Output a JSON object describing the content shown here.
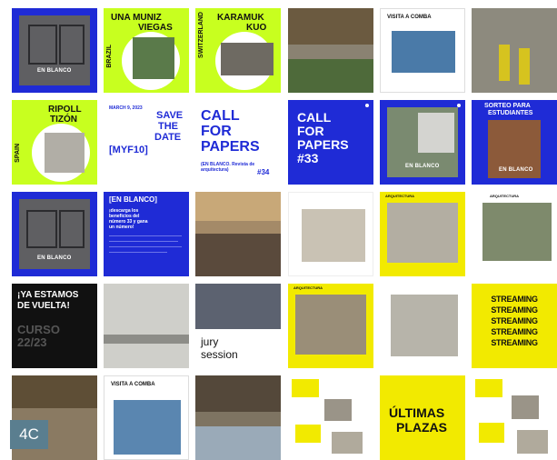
{
  "tiles": {
    "en_blanco_label": "EN BLANCO",
    "brazil": {
      "name_line1": "UNA MUNIZ",
      "name_line2": "VIEGAS",
      "country": "BRAZIL"
    },
    "switzerland": {
      "name_line1": "KARAMUK",
      "name_line2": "KUO",
      "country": "SWITZERLAND"
    },
    "visita_combs_1": "VISITA A COMBA",
    "spain": {
      "name_line1": "RIPOLL",
      "name_line2": "TIZÓN",
      "country": "SPAIN"
    },
    "save_the_date": {
      "date": "MARCH 9, 2023",
      "line1": "SAVE",
      "line2": "THE",
      "line3": "DATE",
      "code": "[MYF10]"
    },
    "call34": {
      "line1": "CALL",
      "line2": "FOR",
      "line3": "PAPERS",
      "sub": "(EN BLANCO. Revista de arquitectura)",
      "num": "#34"
    },
    "call33": {
      "line1": "CALL",
      "line2": "FOR",
      "line3": "PAPERS",
      "num": "#33"
    },
    "sorteo": {
      "line1": "SORTEO PARA",
      "line2": "ESTUDIANTES"
    },
    "en_blanco_card": {
      "title": "[EN BLANCO]",
      "line1": "¡descarga los",
      "line2": "beneficios del",
      "line3": "número 33 y gana",
      "line4": "un número!"
    },
    "ya_estamos": {
      "line1": "¡YA ESTAMOS",
      "line2": "DE",
      "line3": "VUELTA!",
      "curso1": "CURSO",
      "curso2": "22/23"
    },
    "jury": {
      "line1": "jury",
      "line2": "session"
    },
    "arquitectura": "ARQUITECTURA",
    "streaming": [
      "STREAMING",
      "STREAMING",
      "STREAMING",
      "STREAMING",
      "STREAMING"
    ],
    "visita_combs_2": "VISITA A COMBA",
    "ultimas": {
      "line1": "ÚLTIMAS",
      "line2": "PLAZAS"
    }
  },
  "badge": "4C",
  "colors": {
    "blue": "#1f2bd6",
    "lime": "#c8ff1f",
    "yellow": "#f2ea00",
    "black": "#111111"
  }
}
